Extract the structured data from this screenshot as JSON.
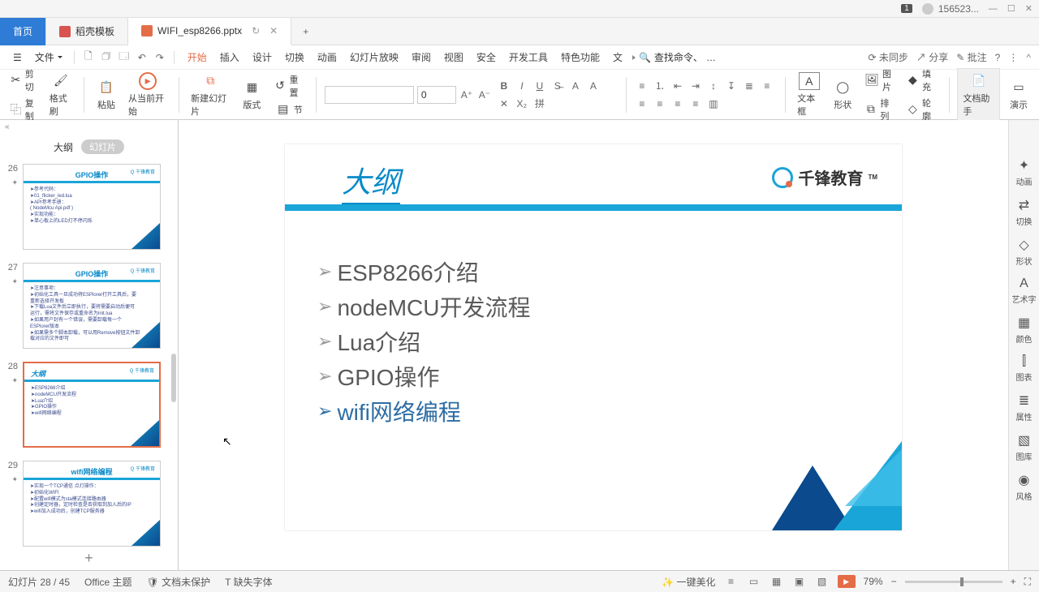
{
  "titlebar": {
    "badge": "1",
    "user": "156523...",
    "min": "—",
    "max": "☐",
    "close": "✕"
  },
  "tabs": {
    "home": "首页",
    "template": "稻壳模板",
    "file_name": "WIFI_esp8266.pptx",
    "restore": "↻",
    "close": "✕",
    "plus": "+"
  },
  "menu": {
    "burger": "☰",
    "file": "文件",
    "items": [
      "开始",
      "插入",
      "设计",
      "切换",
      "动画",
      "幻灯片放映",
      "审阅",
      "视图",
      "安全",
      "开发工具",
      "特色功能",
      "文"
    ],
    "active_index": 0,
    "more": "…",
    "search_label": "查找命令、",
    "sync": "未同步",
    "share": "分享",
    "annotate": "批注",
    "help": "?",
    "menu_dots": "⋮",
    "collapse": "^"
  },
  "toolbar": {
    "cut": "剪切",
    "copy": "复制",
    "format_painter": "格式刷",
    "paste": "粘贴",
    "from_current": "从当前开始",
    "new_slide": "新建幻灯片",
    "layout": "版式",
    "reset": "重置",
    "section": "节",
    "font_size": "0",
    "textbox": "文本框",
    "shape": "形状",
    "picture": "图片",
    "arrange": "排列",
    "fill": "填充",
    "outline": "轮廓",
    "doc_assist": "文档助手",
    "present": "演示"
  },
  "outline": {
    "collapse": "«",
    "text_view": "大纲",
    "thumb_view": "幻灯片",
    "add": "+",
    "slides": [
      {
        "n": 26,
        "title": "GPIO操作",
        "lines": [
          "➤参考代码：",
          "  ➤01_flicker_led.lua",
          "➤API参考手册：",
          "  ( NodeMcu Api.pdf )",
          "➤实现功能：",
          "  ➤单心板上的LED灯不停闪烁"
        ]
      },
      {
        "n": 27,
        "title": "GPIO操作",
        "lines": [
          "➤注意事项：",
          "➤初始化工具一旦成功将ESPlorer打开工具后，要",
          "  重新选择开发板",
          "➤下载Lua文件后立即执行，要将需要启动后便可",
          "  运行，需将文件保存或重命名为init.lua",
          "➤如果用户封有一个错误，需要卸载每一个",
          "  ESPlorer版本",
          "➤如果需多个脚本卸载，可以用Remove按钮文件卸",
          "  载对应的文件即可"
        ]
      },
      {
        "n": 28,
        "title": "大纲",
        "selected": true,
        "lines": [
          "➤ESP8266介绍",
          "➤nodeMCU开发流程",
          "➤Lua介绍",
          "➤GPIO操作",
          "➤wifi网络编程"
        ]
      },
      {
        "n": 29,
        "title": "wifi网络编程",
        "lines": [
          "➤实现一个TCP通信 点灯操作：",
          "  ➤初始化WIFI",
          "  ➤配置wifi模式为sta模式连接路由器",
          "  ➤创建定时器，定时检查是否获取到加入后的IP",
          "  ➤wifi加入成功后，创建TCP服务器"
        ]
      }
    ]
  },
  "slide": {
    "title": "大纲",
    "logo_text": "千锋教育",
    "logo_tm": "TM",
    "items": [
      "ESP8266介绍",
      "nodeMCU开发流程",
      "Lua介绍",
      "GPIO操作",
      "wifi网络编程"
    ],
    "highlight_index": 4
  },
  "side_panel": {
    "items": [
      {
        "icon": "✦",
        "label": "动画"
      },
      {
        "icon": "⇄",
        "label": "切换"
      },
      {
        "icon": "◇",
        "label": "形状"
      },
      {
        "icon": "A",
        "label": "艺术字"
      },
      {
        "icon": "▦",
        "label": "颜色"
      },
      {
        "icon": "⫿",
        "label": "图表"
      },
      {
        "icon": "≣",
        "label": "属性"
      },
      {
        "icon": "▧",
        "label": "图库"
      },
      {
        "icon": "◉",
        "label": "风格"
      }
    ]
  },
  "status": {
    "counter": "幻灯片 28 / 45",
    "theme": "Office 主题",
    "protect": "文档未保护",
    "missing_font": "缺失字体",
    "beautify": "一键美化",
    "zoom_pct": "79%",
    "minus": "−",
    "plus": "+",
    "fit": "⛶"
  }
}
